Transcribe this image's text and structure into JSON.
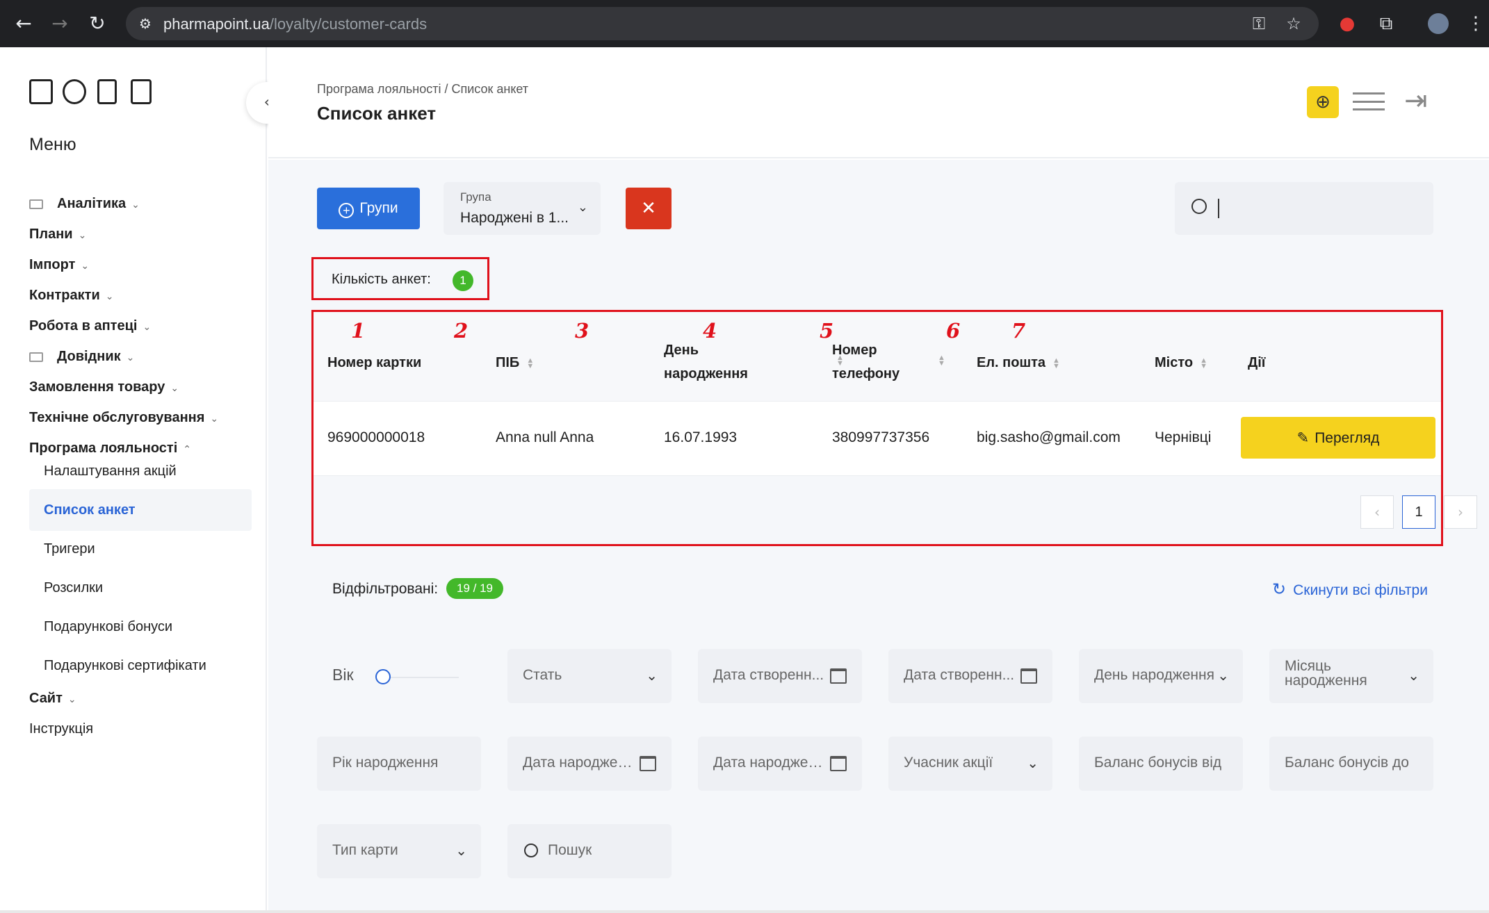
{
  "browser": {
    "url_domain": "pharmapoint.ua",
    "url_path": "/loyalty/customer-cards",
    "back_icon": "←",
    "forward_icon": "→",
    "reload_icon": "↻"
  },
  "sidebar": {
    "menu_title": "Меню",
    "items": [
      {
        "label": "Аналітика"
      },
      {
        "label": "Плани"
      },
      {
        "label": "Імпорт"
      },
      {
        "label": "Контракти"
      },
      {
        "label": "Робота в аптеці"
      },
      {
        "label": "Довідник"
      },
      {
        "label": "Замовлення товару"
      },
      {
        "label": "Технічне обслуговування"
      },
      {
        "label": "Програма лояльності"
      },
      {
        "label": "Сайт"
      },
      {
        "label": "Інструкція"
      }
    ],
    "subitems": [
      {
        "label": "Налаштування акцій"
      },
      {
        "label": "Список анкет"
      },
      {
        "label": "Тригери"
      },
      {
        "label": "Розсилки"
      },
      {
        "label": "Подарункові бонуси"
      },
      {
        "label": "Подарункові сертифікати"
      }
    ]
  },
  "header": {
    "breadcrumb": "Програма лояльності / Список анкет",
    "title": "Список анкет"
  },
  "toolbar": {
    "groups_label": "Групи",
    "group_select_label": "Група",
    "group_select_value": "Народжені в 1...",
    "clear_icon": "✕"
  },
  "count": {
    "label": "Кількість анкет:",
    "value": "1"
  },
  "table": {
    "annotations": [
      "1",
      "2",
      "3",
      "4",
      "5",
      "6",
      "7"
    ],
    "columns": [
      {
        "line1": "Номер картки",
        "line2": ""
      },
      {
        "line1": "ПІБ",
        "line2": ""
      },
      {
        "line1": "День",
        "line2": "народження"
      },
      {
        "line1": "Номер",
        "line2": "телефону"
      },
      {
        "line1": "Ел. пошта",
        "line2": ""
      },
      {
        "line1": "Місто",
        "line2": ""
      },
      {
        "line1": "Дії",
        "line2": ""
      }
    ],
    "rows": [
      {
        "card": "969000000018",
        "name": "Anna null Anna",
        "birthday": "16.07.1993",
        "phone": "380997737356",
        "email": "big.sasho@gmail.com",
        "city": "Чернівці",
        "action": "Перегляд"
      }
    ],
    "pagination": {
      "prev": "‹",
      "current": "1",
      "next": "›"
    }
  },
  "filters": {
    "filtered_label": "Відфільтровані:",
    "filtered_value": "19 / 19",
    "reset_label": "Скинути всі фільтри",
    "age_label": "Вік",
    "fields": [
      "Стать",
      "Дата створенн...",
      "Дата створенн...",
      "День народження",
      "Місяць народження",
      "Рік народження",
      "Дата народжен...",
      "Дата народжен...",
      "Учасник акції",
      "Баланс бонусів від",
      "Баланс бонусів до",
      "Тип карти",
      "Пошук"
    ]
  },
  "colors": {
    "accent_blue": "#2a6fdb",
    "yellow": "#f5d21e",
    "red": "#d9361e",
    "annotation_red": "#e0111b",
    "green": "#43b82a"
  }
}
